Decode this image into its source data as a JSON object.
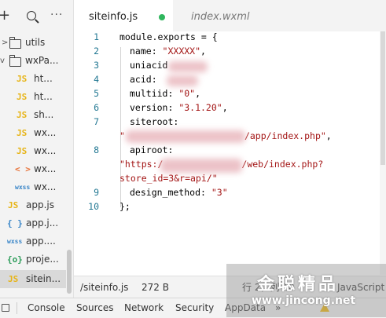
{
  "sidebar": {
    "items": [
      {
        "label": "utils",
        "icon": "folder"
      },
      {
        "label": "wxPa...",
        "icon": "folder-open"
      },
      {
        "label": "ht...",
        "icon": "js"
      },
      {
        "label": "ht...",
        "icon": "js"
      },
      {
        "label": "sh...",
        "icon": "js"
      },
      {
        "label": "wx...",
        "icon": "js"
      },
      {
        "label": "wx...",
        "icon": "js"
      },
      {
        "label": "wx...",
        "icon": "wxml"
      },
      {
        "label": "wx...",
        "icon": "wxss"
      },
      {
        "label": "app.js",
        "icon": "js"
      },
      {
        "label": "app.j...",
        "icon": "json"
      },
      {
        "label": "app....",
        "icon": "wxss"
      },
      {
        "label": "proje...",
        "icon": "project"
      },
      {
        "label": "sitein...",
        "icon": "js"
      }
    ],
    "icon_text": {
      "js": "JS",
      "json": "{ }",
      "wxss": "wxss",
      "wxml": "< >",
      "project": "{o}"
    }
  },
  "tabs": {
    "active": {
      "label": "siteinfo.js",
      "modified_dot_color": "#2fb65d"
    },
    "inactive": {
      "label": "index.wxml"
    }
  },
  "editor": {
    "line_numbers": [
      "1",
      "2",
      "3",
      "4",
      "5",
      "6",
      "7",
      "8",
      "9",
      "10"
    ],
    "lines": {
      "l1": "module.exports = {",
      "l2_key": "name: ",
      "l2_val": "\"XXXXX\"",
      "l2_end": ",",
      "l3": "uniacid",
      "l4": "acid:",
      "l5_key": "multiid: ",
      "l5_val": "\"0\"",
      "l5_end": ",",
      "l6_key": "version: ",
      "l6_val": "\"3.1.20\"",
      "l6_end": ",",
      "l7": "siteroot:",
      "l7b_a": "\"",
      "l7b_b": "/app/index.php\"",
      "l7b_end": ",",
      "l8": "apiroot:",
      "l8b_a": "\"https:/",
      "l8b_b": "/web/index.php?",
      "l8c": "store_id=3&r=api/\"",
      "l9_key": "design_method: ",
      "l9_val": "\"3\"",
      "l10": "};"
    }
  },
  "statusbar": {
    "path": "/siteinfo.js",
    "size": "272 B",
    "position": "行 2，列 10",
    "language": "JavaScript"
  },
  "devtools": {
    "tabs": [
      "Console",
      "Sources",
      "Network",
      "Security",
      "AppData"
    ],
    "more": "»"
  },
  "watermark": {
    "title": "金聪精品",
    "url": "www.jincong.net"
  }
}
